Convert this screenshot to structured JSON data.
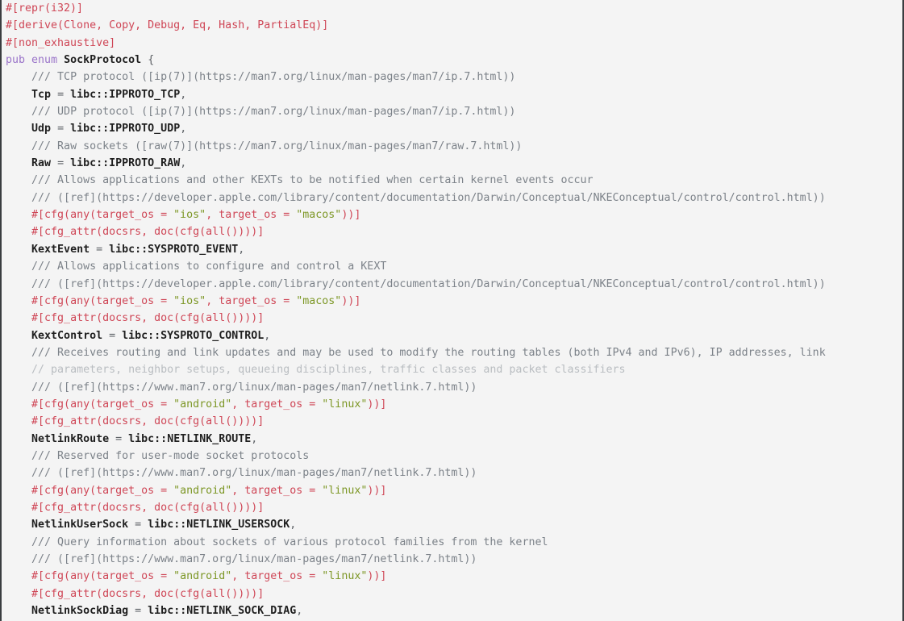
{
  "viewer": {
    "language": "rust",
    "background_color": "#f4f4f4",
    "border_color": "#3a3d40",
    "font_size_px": 13.3,
    "line_height_px": 21.35
  },
  "palette": {
    "attribute": "#cf4656",
    "string": "#7d9726",
    "doc_comment": "#7c8289",
    "dim_comment": "#b9bdc1",
    "keyword": "#9a74c9",
    "identifier": "#1f1f1f",
    "plain": "#2c2c2c",
    "punctuation": "#5d6166"
  },
  "code": {
    "lines": [
      {
        "n": 1,
        "text": "#[repr(i32)]",
        "kind": "attribute"
      },
      {
        "n": 2,
        "text": "#[derive(Clone, Copy, Debug, Eq, Hash, PartialEq)]",
        "kind": "attribute"
      },
      {
        "n": 3,
        "text": "#[non_exhaustive]",
        "kind": "attribute"
      },
      {
        "n": 4,
        "text": "pub enum SockProtocol {",
        "kind": "declaration"
      },
      {
        "n": 5,
        "text": "    /// TCP protocol ([ip(7)](https://man7.org/linux/man-pages/man7/ip.7.html))",
        "kind": "doc"
      },
      {
        "n": 6,
        "text": "    Tcp = libc::IPPROTO_TCP,",
        "kind": "variant"
      },
      {
        "n": 7,
        "text": "    /// UDP protocol ([ip(7)](https://man7.org/linux/man-pages/man7/ip.7.html))",
        "kind": "doc"
      },
      {
        "n": 8,
        "text": "    Udp = libc::IPPROTO_UDP,",
        "kind": "variant"
      },
      {
        "n": 9,
        "text": "    /// Raw sockets ([raw(7)](https://man7.org/linux/man-pages/man7/raw.7.html))",
        "kind": "doc"
      },
      {
        "n": 10,
        "text": "    Raw = libc::IPPROTO_RAW,",
        "kind": "variant"
      },
      {
        "n": 11,
        "text": "    /// Allows applications and other KEXTs to be notified when certain kernel events occur",
        "kind": "doc"
      },
      {
        "n": 12,
        "text": "    /// ([ref](https://developer.apple.com/library/content/documentation/Darwin/Conceptual/NKEConceptual/control/control.html))",
        "kind": "doc"
      },
      {
        "n": 13,
        "text": "    #[cfg(any(target_os = \"ios\", target_os = \"macos\"))]",
        "kind": "cfg"
      },
      {
        "n": 14,
        "text": "    #[cfg_attr(docsrs, doc(cfg(all())))]",
        "kind": "attribute"
      },
      {
        "n": 15,
        "text": "    KextEvent = libc::SYSPROTO_EVENT,",
        "kind": "variant"
      },
      {
        "n": 16,
        "text": "    /// Allows applications to configure and control a KEXT",
        "kind": "doc"
      },
      {
        "n": 17,
        "text": "    /// ([ref](https://developer.apple.com/library/content/documentation/Darwin/Conceptual/NKEConceptual/control/control.html))",
        "kind": "doc"
      },
      {
        "n": 18,
        "text": "    #[cfg(any(target_os = \"ios\", target_os = \"macos\"))]",
        "kind": "cfg"
      },
      {
        "n": 19,
        "text": "    #[cfg_attr(docsrs, doc(cfg(all())))]",
        "kind": "attribute"
      },
      {
        "n": 20,
        "text": "    KextControl = libc::SYSPROTO_CONTROL,",
        "kind": "variant"
      },
      {
        "n": 21,
        "text": "    /// Receives routing and link updates and may be used to modify the routing tables (both IPv4 and IPv6), IP addresses, link",
        "kind": "doc"
      },
      {
        "n": 22,
        "text": "    // parameters, neighbor setups, queueing disciplines, traffic classes and packet classifiers",
        "kind": "dim"
      },
      {
        "n": 23,
        "text": "    /// ([ref](https://www.man7.org/linux/man-pages/man7/netlink.7.html))",
        "kind": "doc"
      },
      {
        "n": 24,
        "text": "    #[cfg(any(target_os = \"android\", target_os = \"linux\"))]",
        "kind": "cfg"
      },
      {
        "n": 25,
        "text": "    #[cfg_attr(docsrs, doc(cfg(all())))]",
        "kind": "attribute"
      },
      {
        "n": 26,
        "text": "    NetlinkRoute = libc::NETLINK_ROUTE,",
        "kind": "variant"
      },
      {
        "n": 27,
        "text": "    /// Reserved for user-mode socket protocols",
        "kind": "doc"
      },
      {
        "n": 28,
        "text": "    /// ([ref](https://www.man7.org/linux/man-pages/man7/netlink.7.html))",
        "kind": "doc"
      },
      {
        "n": 29,
        "text": "    #[cfg(any(target_os = \"android\", target_os = \"linux\"))]",
        "kind": "cfg"
      },
      {
        "n": 30,
        "text": "    #[cfg_attr(docsrs, doc(cfg(all())))]",
        "kind": "attribute"
      },
      {
        "n": 31,
        "text": "    NetlinkUserSock = libc::NETLINK_USERSOCK,",
        "kind": "variant"
      },
      {
        "n": 32,
        "text": "    /// Query information about sockets of various protocol families from the kernel",
        "kind": "doc"
      },
      {
        "n": 33,
        "text": "    /// ([ref](https://www.man7.org/linux/man-pages/man7/netlink.7.html))",
        "kind": "doc"
      },
      {
        "n": 34,
        "text": "    #[cfg(any(target_os = \"android\", target_os = \"linux\"))]",
        "kind": "cfg"
      },
      {
        "n": 35,
        "text": "    #[cfg_attr(docsrs, doc(cfg(all())))]",
        "kind": "attribute"
      },
      {
        "n": 36,
        "text": "    NetlinkSockDiag = libc::NETLINK_SOCK_DIAG,",
        "kind": "variant"
      }
    ]
  }
}
